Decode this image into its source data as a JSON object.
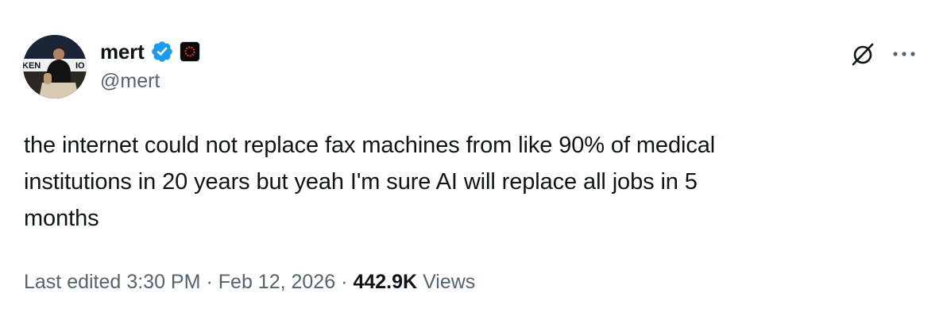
{
  "author": {
    "display_name": "mert",
    "handle": "@mert",
    "avatar_text": "KEN",
    "avatar_text_right": "IO"
  },
  "tweet": {
    "text": "the internet could not replace fax machines from like 90% of medical\ninstitutions in 20 years but yeah I'm sure AI will replace all jobs in 5\nmonths"
  },
  "meta": {
    "edited_label": "Last edited",
    "time": "3:30 PM",
    "separator": "·",
    "date": "Feb 12, 2026",
    "views_count": "442.9K",
    "views_label": "Views"
  },
  "icons": {
    "verified": "verified-badge-icon",
    "affiliate": "affiliate-badge-icon",
    "grok": "grok-icon",
    "more": "more-icon"
  },
  "colors": {
    "verified_blue": "#1d9bf0",
    "text_primary": "#0f1419",
    "text_secondary": "#536471",
    "affiliate_red": "#e0301e"
  }
}
